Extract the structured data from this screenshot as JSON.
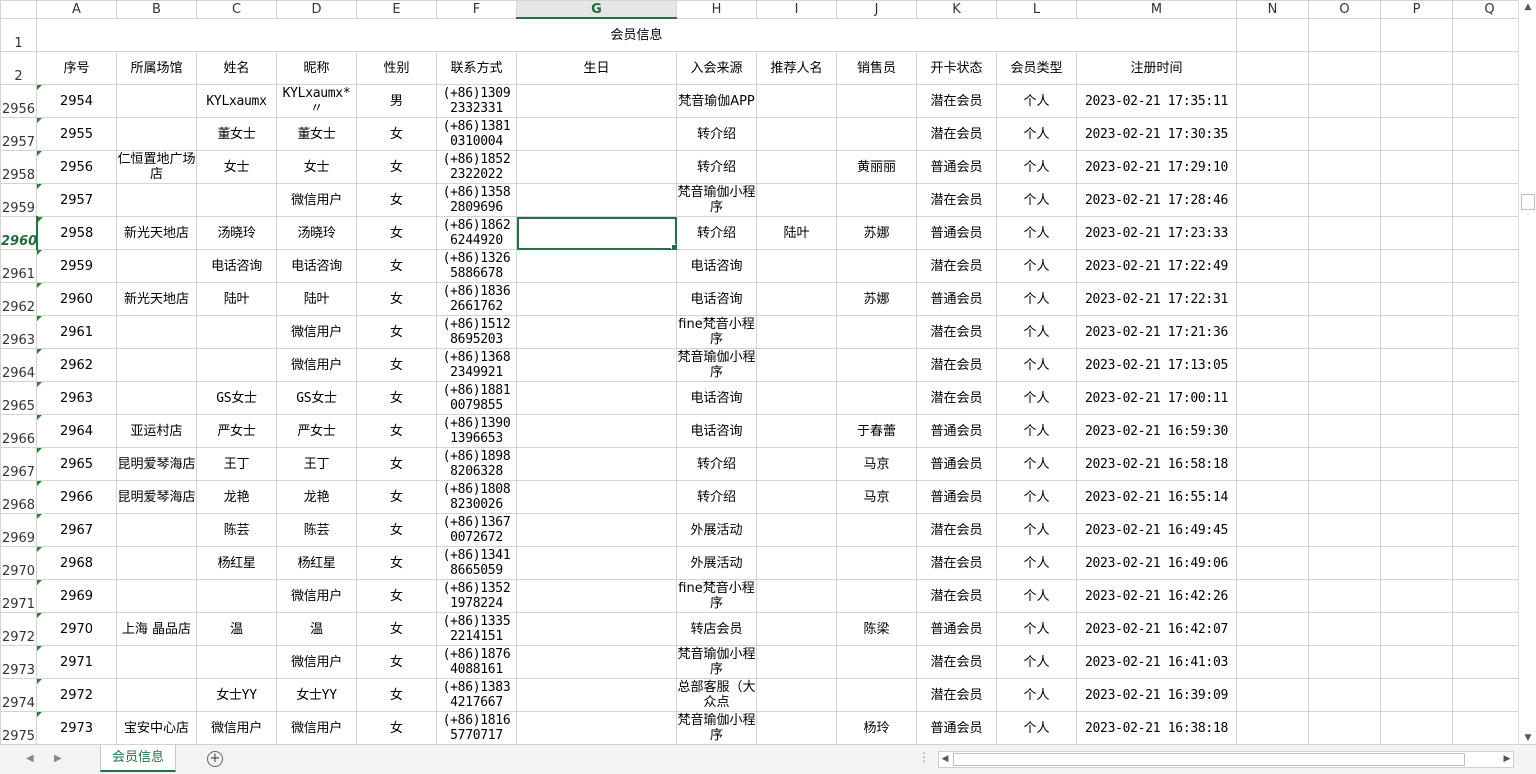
{
  "columns": [
    "A",
    "B",
    "C",
    "D",
    "E",
    "F",
    "G",
    "H",
    "I",
    "J",
    "K",
    "L",
    "M",
    "N",
    "O",
    "P",
    "Q"
  ],
  "selected_column": "G",
  "row1": {
    "num": "1",
    "title": "会员信息"
  },
  "row2": {
    "num": "2",
    "headers": [
      "序号",
      "所属场馆",
      "姓名",
      "昵称",
      "性别",
      "联系方式",
      "生日",
      "入会来源",
      "推荐人名",
      "销售员",
      "开卡状态",
      "会员类型",
      "注册时间"
    ]
  },
  "rows": [
    {
      "rownum": "2956",
      "id": "2954",
      "venue": "",
      "name": "KYLxaumx",
      "nick": "KYLxaumx*〃",
      "gender": "男",
      "phone": "(+86)1309 2332331",
      "birthday": "",
      "source": "梵音瑜伽APP",
      "referrer": "",
      "sales": "",
      "status": "潜在会员",
      "type": "个人",
      "regtime": "2023-02-21 17:35:11"
    },
    {
      "rownum": "2957",
      "id": "2955",
      "venue": "",
      "name": "董女士",
      "nick": "董女士",
      "gender": "女",
      "phone": "(+86)1381 0310004",
      "birthday": "",
      "source": "转介绍",
      "referrer": "",
      "sales": "",
      "status": "潜在会员",
      "type": "个人",
      "regtime": "2023-02-21 17:30:35"
    },
    {
      "rownum": "2958",
      "id": "2956",
      "venue": "仁恒置地广场店",
      "name": "女士",
      "nick": "女士",
      "gender": "女",
      "phone": "(+86)1852 2322022",
      "birthday": "",
      "source": "转介绍",
      "referrer": "",
      "sales": "黄丽丽",
      "status": "普通会员",
      "type": "个人",
      "regtime": "2023-02-21 17:29:10"
    },
    {
      "rownum": "2959",
      "id": "2957",
      "venue": "",
      "name": "",
      "nick": "微信用户",
      "gender": "女",
      "phone": "(+86)1358 2809696",
      "birthday": "",
      "source": "梵音瑜伽小程序",
      "referrer": "",
      "sales": "",
      "status": "潜在会员",
      "type": "个人",
      "regtime": "2023-02-21 17:28:46"
    },
    {
      "rownum": "2960",
      "id": "2958",
      "venue": "新光天地店",
      "name": "汤晓玲",
      "nick": "汤晓玲",
      "gender": "女",
      "phone": "(+86)1862 6244920",
      "birthday": "",
      "source": "转介绍",
      "referrer": "陆叶",
      "sales": "苏娜",
      "status": "普通会员",
      "type": "个人",
      "regtime": "2023-02-21 17:23:33"
    },
    {
      "rownum": "2961",
      "id": "2959",
      "venue": "",
      "name": "电话咨询",
      "nick": "电话咨询",
      "gender": "女",
      "phone": "(+86)1326 5886678",
      "birthday": "",
      "source": "电话咨询",
      "referrer": "",
      "sales": "",
      "status": "潜在会员",
      "type": "个人",
      "regtime": "2023-02-21 17:22:49"
    },
    {
      "rownum": "2962",
      "id": "2960",
      "venue": "新光天地店",
      "name": "陆叶",
      "nick": "陆叶",
      "gender": "女",
      "phone": "(+86)1836 2661762",
      "birthday": "",
      "source": "电话咨询",
      "referrer": "",
      "sales": "苏娜",
      "status": "普通会员",
      "type": "个人",
      "regtime": "2023-02-21 17:22:31"
    },
    {
      "rownum": "2963",
      "id": "2961",
      "venue": "",
      "name": "",
      "nick": "微信用户",
      "gender": "女",
      "phone": "(+86)1512 8695203",
      "birthday": "",
      "source": "fine梵音小程序",
      "referrer": "",
      "sales": "",
      "status": "潜在会员",
      "type": "个人",
      "regtime": "2023-02-21 17:21:36"
    },
    {
      "rownum": "2964",
      "id": "2962",
      "venue": "",
      "name": "",
      "nick": "微信用户",
      "gender": "女",
      "phone": "(+86)1368 2349921",
      "birthday": "",
      "source": "梵音瑜伽小程序",
      "referrer": "",
      "sales": "",
      "status": "潜在会员",
      "type": "个人",
      "regtime": "2023-02-21 17:13:05"
    },
    {
      "rownum": "2965",
      "id": "2963",
      "venue": "",
      "name": "GS女士",
      "nick": "GS女士",
      "gender": "女",
      "phone": "(+86)1881 0079855",
      "birthday": "",
      "source": "电话咨询",
      "referrer": "",
      "sales": "",
      "status": "潜在会员",
      "type": "个人",
      "regtime": "2023-02-21 17:00:11"
    },
    {
      "rownum": "2966",
      "id": "2964",
      "venue": "亚运村店",
      "name": "严女士",
      "nick": "严女士",
      "gender": "女",
      "phone": "(+86)1390 1396653",
      "birthday": "",
      "source": "电话咨询",
      "referrer": "",
      "sales": "于春蕾",
      "status": "普通会员",
      "type": "个人",
      "regtime": "2023-02-21 16:59:30"
    },
    {
      "rownum": "2967",
      "id": "2965",
      "venue": "昆明爱琴海店",
      "name": "王丁",
      "nick": "王丁",
      "gender": "女",
      "phone": "(+86)1898 8206328",
      "birthday": "",
      "source": "转介绍",
      "referrer": "",
      "sales": "马京",
      "status": "普通会员",
      "type": "个人",
      "regtime": "2023-02-21 16:58:18"
    },
    {
      "rownum": "2968",
      "id": "2966",
      "venue": "昆明爱琴海店",
      "name": "龙艳",
      "nick": "龙艳",
      "gender": "女",
      "phone": "(+86)1808 8230026",
      "birthday": "",
      "source": "转介绍",
      "referrer": "",
      "sales": "马京",
      "status": "普通会员",
      "type": "个人",
      "regtime": "2023-02-21 16:55:14"
    },
    {
      "rownum": "2969",
      "id": "2967",
      "venue": "",
      "name": "陈芸",
      "nick": "陈芸",
      "gender": "女",
      "phone": "(+86)1367 0072672",
      "birthday": "",
      "source": "外展活动",
      "referrer": "",
      "sales": "",
      "status": "潜在会员",
      "type": "个人",
      "regtime": "2023-02-21 16:49:45"
    },
    {
      "rownum": "2970",
      "id": "2968",
      "venue": "",
      "name": "杨红星",
      "nick": "杨红星",
      "gender": "女",
      "phone": "(+86)1341 8665059",
      "birthday": "",
      "source": "外展活动",
      "referrer": "",
      "sales": "",
      "status": "潜在会员",
      "type": "个人",
      "regtime": "2023-02-21 16:49:06"
    },
    {
      "rownum": "2971",
      "id": "2969",
      "venue": "",
      "name": "",
      "nick": "微信用户",
      "gender": "女",
      "phone": "(+86)1352 1978224",
      "birthday": "",
      "source": "fine梵音小程序",
      "referrer": "",
      "sales": "",
      "status": "潜在会员",
      "type": "个人",
      "regtime": "2023-02-21 16:42:26"
    },
    {
      "rownum": "2972",
      "id": "2970",
      "venue": "上海 晶品店",
      "name": "温",
      "nick": "温",
      "gender": "女",
      "phone": "(+86)1335 2214151",
      "birthday": "",
      "source": "转店会员",
      "referrer": "",
      "sales": "陈梁",
      "status": "普通会员",
      "type": "个人",
      "regtime": "2023-02-21 16:42:07"
    },
    {
      "rownum": "2973",
      "id": "2971",
      "venue": "",
      "name": "",
      "nick": "微信用户",
      "gender": "女",
      "phone": "(+86)1876 4088161",
      "birthday": "",
      "source": "梵音瑜伽小程序",
      "referrer": "",
      "sales": "",
      "status": "潜在会员",
      "type": "个人",
      "regtime": "2023-02-21 16:41:03"
    },
    {
      "rownum": "2974",
      "id": "2972",
      "venue": "",
      "name": "女士YY",
      "nick": "女士YY",
      "gender": "女",
      "phone": "(+86)1383 4217667",
      "birthday": "",
      "source": "总部客服（大众点",
      "referrer": "",
      "sales": "",
      "status": "潜在会员",
      "type": "个人",
      "regtime": "2023-02-21 16:39:09"
    },
    {
      "rownum": "2975",
      "id": "2973",
      "venue": "宝安中心店",
      "name": "微信用户",
      "nick": "微信用户",
      "gender": "女",
      "phone": "(+86)1816 5770717",
      "birthday": "",
      "source": "梵音瑜伽小程序",
      "referrer": "",
      "sales": "杨玲",
      "status": "普通会员",
      "type": "个人",
      "regtime": "2023-02-21 16:38:18"
    }
  ],
  "active_row": "2960",
  "sheet_tab": "会员信息",
  "icons": {
    "prev": "prev-sheet-icon",
    "next": "next-sheet-icon",
    "add": "add-sheet-icon"
  }
}
